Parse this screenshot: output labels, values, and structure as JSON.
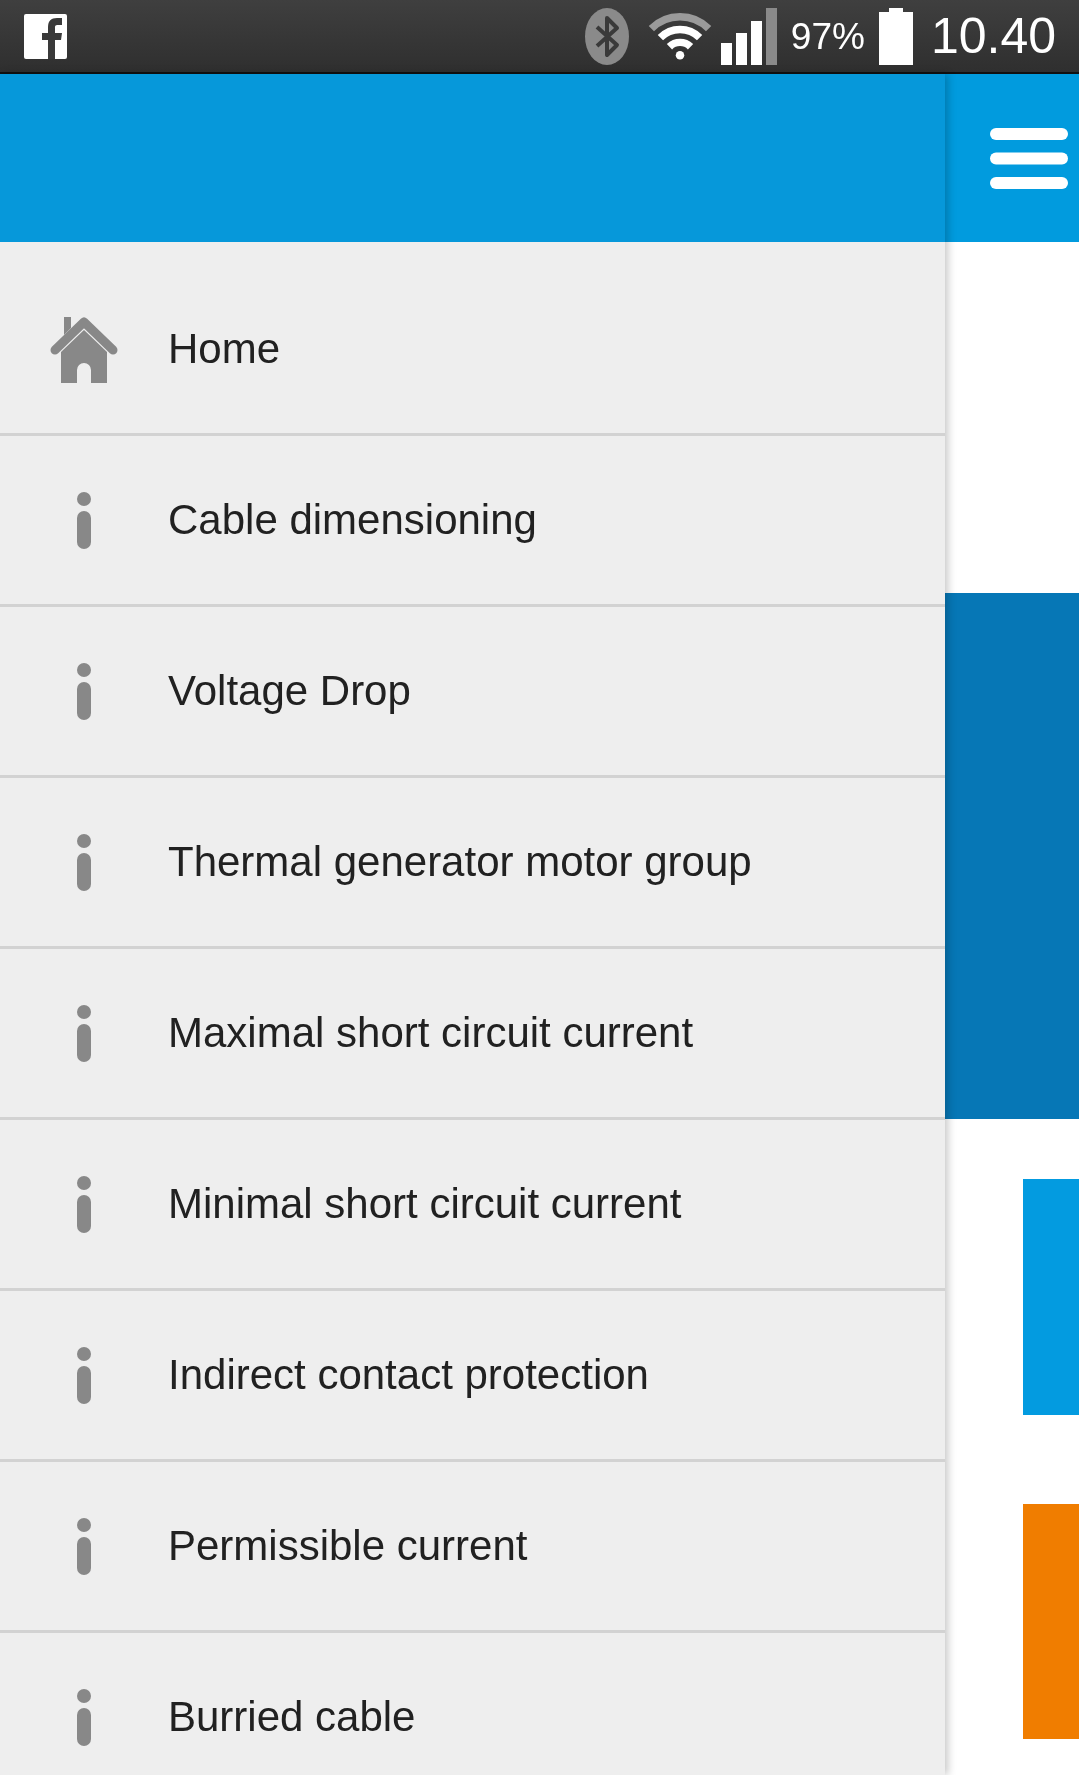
{
  "status_bar": {
    "battery": "97%",
    "time": "10.40"
  },
  "drawer": {
    "items": [
      {
        "label": "Home",
        "kind": "home"
      },
      {
        "label": "Cable dimensioning",
        "kind": "info"
      },
      {
        "label": "Voltage Drop",
        "kind": "info"
      },
      {
        "label": "Thermal generator motor group",
        "kind": "info"
      },
      {
        "label": "Maximal short circuit current",
        "kind": "info"
      },
      {
        "label": "Minimal short circuit current",
        "kind": "info"
      },
      {
        "label": "Indirect contact protection",
        "kind": "info"
      },
      {
        "label": "Permissible current",
        "kind": "info"
      },
      {
        "label": "Burried cable",
        "kind": "info"
      }
    ]
  }
}
